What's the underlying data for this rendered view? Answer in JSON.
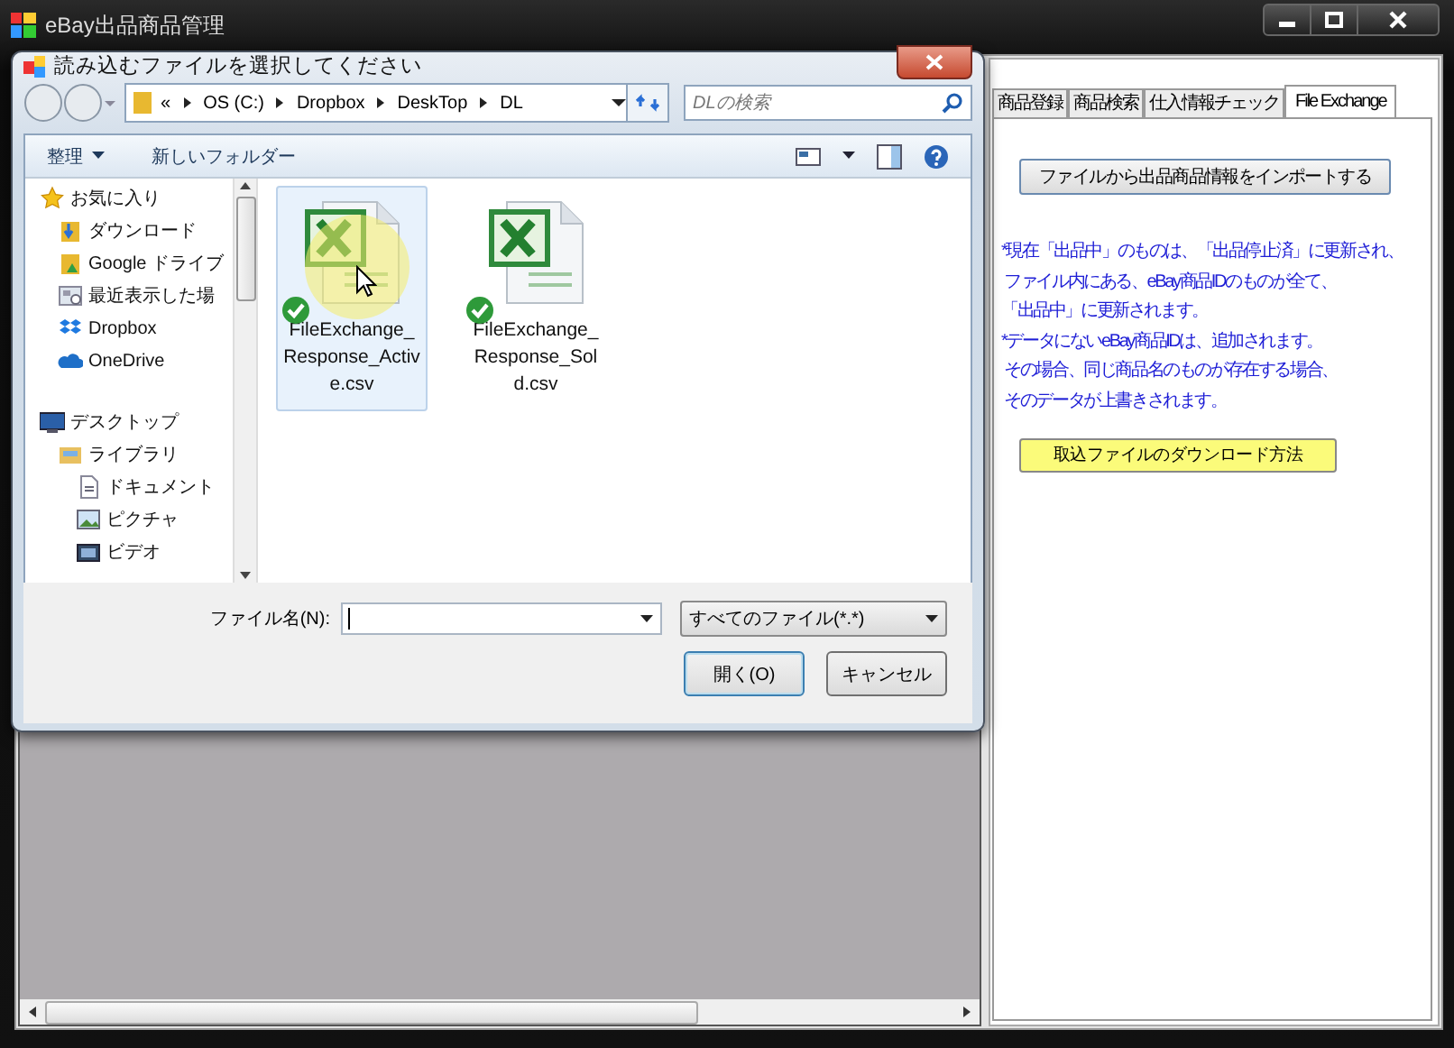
{
  "main_window": {
    "title": "eBay出品商品管理"
  },
  "dialog": {
    "title": "読み込むファイルを選択してください",
    "address": {
      "overflow": "«",
      "crumbs": [
        "OS (C:)",
        "Dropbox",
        "DeskTop",
        "DL"
      ]
    },
    "search": {
      "placeholder": "DLの検索"
    },
    "toolbar": {
      "organize": "整理",
      "new_folder": "新しいフォルダー"
    },
    "nav": [
      {
        "label": "お気に入り",
        "kind": "favorites",
        "children": [
          {
            "label": "ダウンロード",
            "kind": "downloads"
          },
          {
            "label": "Google ドライブ",
            "kind": "google_drive"
          },
          {
            "label": "最近表示した場",
            "kind": "recent"
          },
          {
            "label": "Dropbox",
            "kind": "dropbox"
          },
          {
            "label": "OneDrive",
            "kind": "onedrive"
          }
        ]
      },
      {
        "label": "デスクトップ",
        "kind": "desktop",
        "children": [
          {
            "label": "ライブラリ",
            "kind": "library",
            "children": [
              {
                "label": "ドキュメント",
                "kind": "documents"
              },
              {
                "label": "ピクチャ",
                "kind": "pictures"
              },
              {
                "label": "ビデオ",
                "kind": "videos"
              }
            ]
          }
        ]
      }
    ],
    "files": [
      {
        "name": "FileExchange_Response_Active.csv",
        "selected": true,
        "synced": true
      },
      {
        "name": "FileExchange_Response_Sold.csv",
        "selected": false,
        "synced": true
      }
    ],
    "file_name": {
      "label": "ファイル名(N):"
    },
    "file_type": "すべてのファイル(*.*)",
    "buttons": [
      {
        "label": "開く(O)",
        "default": true
      },
      {
        "label": "キャンセル",
        "default": false
      }
    ]
  },
  "right_panel": {
    "tabs": [
      {
        "label": "商品登録",
        "selected": false
      },
      {
        "label": "商品検索",
        "selected": false
      },
      {
        "label": "仕入情報チェック",
        "selected": false
      },
      {
        "label": "File Exchange",
        "selected": true
      }
    ],
    "import_button": "ファイルから出品商品情報をインポートする",
    "notes": [
      "*現在「出品中」のものは、「出品停止済」に更新され、",
      " ファイル内にある、eBay商品IDのものが全て、",
      "「出品中」に更新されます。",
      "*データにないeBay商品IDは、追加されます。",
      " その場合、同じ商品名のものが存在する場合、",
      " そのデータが上書きされます。"
    ],
    "help_button": "取込ファイルのダウンロード方法"
  }
}
